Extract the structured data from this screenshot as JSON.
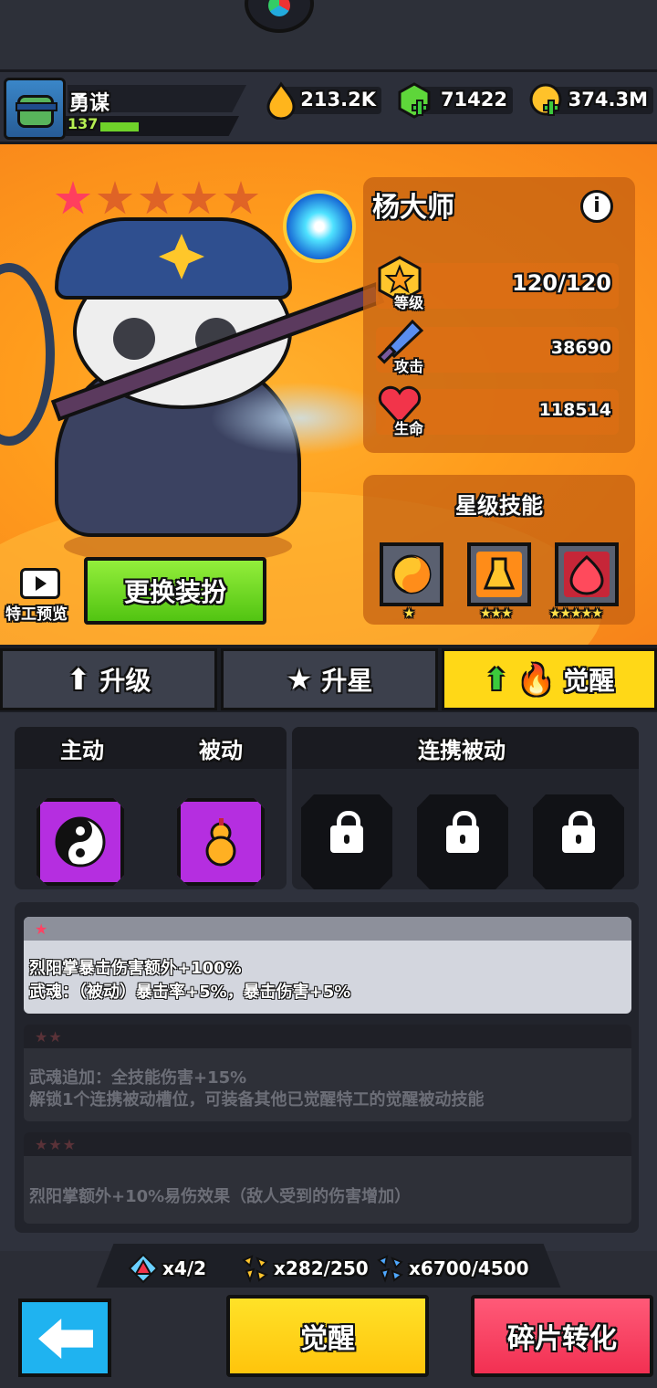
{
  "player": {
    "name": "勇谋",
    "level": "137",
    "xp_progress": 0.28
  },
  "resources": [
    {
      "icon": "flame-drop-icon",
      "value": "213.2K"
    },
    {
      "icon": "green-gem-icon",
      "value": "71422"
    },
    {
      "icon": "gold-coin-icon",
      "value": "374.3M"
    }
  ],
  "hero": {
    "name": "杨大师",
    "stars_lit": 1,
    "stars_total": 5,
    "stats": [
      {
        "label": "等级",
        "value": "120/120",
        "icon": "level-medal-icon"
      },
      {
        "label": "攻击",
        "value": "38690",
        "icon": "sword-icon"
      },
      {
        "label": "生命",
        "value": "118514",
        "icon": "heart-icon"
      }
    ]
  },
  "preview_label": "特工预览",
  "change_outfit_label": "更换装扮",
  "star_skills": {
    "title": "星级技能",
    "items": [
      {
        "icon": "yinyang-icon",
        "stars": "★"
      },
      {
        "icon": "fire-flask-icon",
        "stars": "★★★"
      },
      {
        "icon": "demon-flame-icon",
        "stars": "★★★★★"
      }
    ]
  },
  "tabs": [
    {
      "label": "升级",
      "icon": "arrow-up-icon"
    },
    {
      "label": "升星",
      "icon": "star-icon"
    },
    {
      "label": "觉醒",
      "icon": "awaken-flame-icon",
      "active": true
    }
  ],
  "skill_types": {
    "active": "主动",
    "passive": "被动",
    "linked_passive": "连携被动"
  },
  "awaken_tiers": [
    {
      "stars": "★",
      "lines": [
        "烈阳掌暴击伤害额外+100%",
        "武魂：（被动）暴击率+5%，暴击伤害+5%"
      ],
      "unlocked": true
    },
    {
      "stars": "★★",
      "lines": [
        "武魂追加：全技能伤害+15%",
        "解锁1个连携被动槽位，可装备其他已觉醒特工的觉醒被动技能"
      ],
      "unlocked": false
    },
    {
      "stars": "★★★",
      "lines": [
        "烈阳掌额外+10%易伤效果（敌人受到的伤害增加）"
      ],
      "unlocked": false
    }
  ],
  "materials": [
    {
      "icon": "triangle-rune-icon",
      "value": "x4/2"
    },
    {
      "icon": "gold-fragment-icon",
      "value": "x282/250"
    },
    {
      "icon": "blue-fragment-icon",
      "value": "x6700/4500"
    }
  ],
  "buttons": {
    "awaken": "觉醒",
    "convert": "碎片转化"
  },
  "colors": {
    "accent_orange": "#ff9c1c",
    "awaken_yellow": "#ffd817",
    "convert_red": "#f23052",
    "outfit_green": "#52c412",
    "back_blue": "#1fb3f0"
  }
}
